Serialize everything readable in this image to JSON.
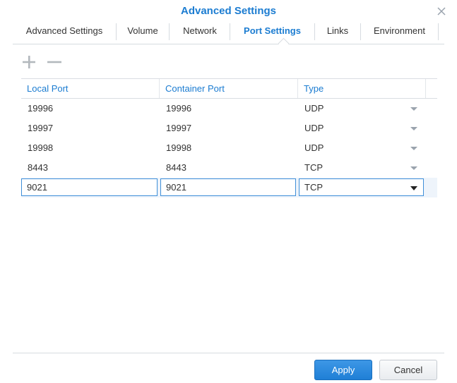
{
  "dialog": {
    "title": "Advanced Settings"
  },
  "tabs": [
    {
      "label": "Advanced Settings",
      "active": false
    },
    {
      "label": "Volume",
      "active": false
    },
    {
      "label": "Network",
      "active": false
    },
    {
      "label": "Port Settings",
      "active": true
    },
    {
      "label": "Links",
      "active": false
    },
    {
      "label": "Environment",
      "active": false
    }
  ],
  "toolbar": {
    "add_icon": "plus-icon",
    "remove_icon": "minus-icon"
  },
  "table": {
    "columns": [
      "Local Port",
      "Container Port",
      "Type"
    ],
    "rows": [
      {
        "local": "19996",
        "container": "19996",
        "type": "UDP"
      },
      {
        "local": "19997",
        "container": "19997",
        "type": "UDP"
      },
      {
        "local": "19998",
        "container": "19998",
        "type": "UDP"
      },
      {
        "local": "8443",
        "container": "8443",
        "type": "TCP"
      }
    ],
    "editing_row": {
      "local": "9021",
      "container": "9021",
      "type": "TCP"
    }
  },
  "buttons": {
    "apply": "Apply",
    "cancel": "Cancel"
  },
  "colors": {
    "accent": "#1b7cd1",
    "apply_button": "#2587dc"
  }
}
